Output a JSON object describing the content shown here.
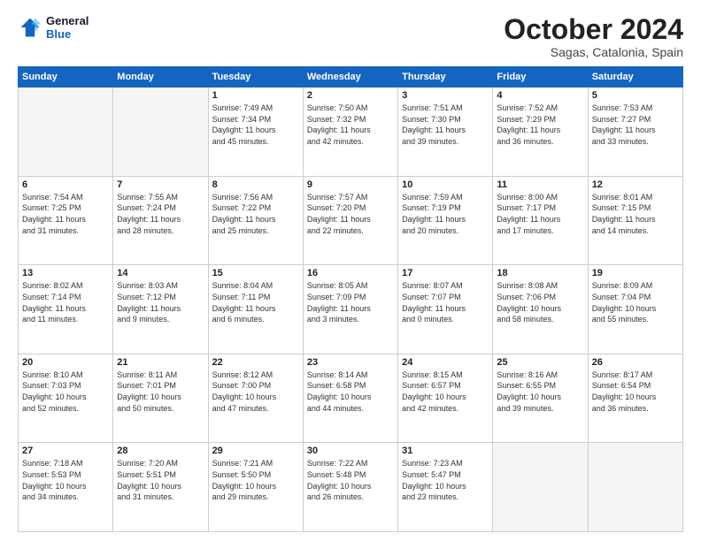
{
  "logo": {
    "line1": "General",
    "line2": "Blue"
  },
  "title": "October 2024",
  "location": "Sagas, Catalonia, Spain",
  "days_header": [
    "Sunday",
    "Monday",
    "Tuesday",
    "Wednesday",
    "Thursday",
    "Friday",
    "Saturday"
  ],
  "weeks": [
    [
      {
        "day": "",
        "info": ""
      },
      {
        "day": "",
        "info": ""
      },
      {
        "day": "1",
        "info": "Sunrise: 7:49 AM\nSunset: 7:34 PM\nDaylight: 11 hours\nand 45 minutes."
      },
      {
        "day": "2",
        "info": "Sunrise: 7:50 AM\nSunset: 7:32 PM\nDaylight: 11 hours\nand 42 minutes."
      },
      {
        "day": "3",
        "info": "Sunrise: 7:51 AM\nSunset: 7:30 PM\nDaylight: 11 hours\nand 39 minutes."
      },
      {
        "day": "4",
        "info": "Sunrise: 7:52 AM\nSunset: 7:29 PM\nDaylight: 11 hours\nand 36 minutes."
      },
      {
        "day": "5",
        "info": "Sunrise: 7:53 AM\nSunset: 7:27 PM\nDaylight: 11 hours\nand 33 minutes."
      }
    ],
    [
      {
        "day": "6",
        "info": "Sunrise: 7:54 AM\nSunset: 7:25 PM\nDaylight: 11 hours\nand 31 minutes."
      },
      {
        "day": "7",
        "info": "Sunrise: 7:55 AM\nSunset: 7:24 PM\nDaylight: 11 hours\nand 28 minutes."
      },
      {
        "day": "8",
        "info": "Sunrise: 7:56 AM\nSunset: 7:22 PM\nDaylight: 11 hours\nand 25 minutes."
      },
      {
        "day": "9",
        "info": "Sunrise: 7:57 AM\nSunset: 7:20 PM\nDaylight: 11 hours\nand 22 minutes."
      },
      {
        "day": "10",
        "info": "Sunrise: 7:59 AM\nSunset: 7:19 PM\nDaylight: 11 hours\nand 20 minutes."
      },
      {
        "day": "11",
        "info": "Sunrise: 8:00 AM\nSunset: 7:17 PM\nDaylight: 11 hours\nand 17 minutes."
      },
      {
        "day": "12",
        "info": "Sunrise: 8:01 AM\nSunset: 7:15 PM\nDaylight: 11 hours\nand 14 minutes."
      }
    ],
    [
      {
        "day": "13",
        "info": "Sunrise: 8:02 AM\nSunset: 7:14 PM\nDaylight: 11 hours\nand 11 minutes."
      },
      {
        "day": "14",
        "info": "Sunrise: 8:03 AM\nSunset: 7:12 PM\nDaylight: 11 hours\nand 9 minutes."
      },
      {
        "day": "15",
        "info": "Sunrise: 8:04 AM\nSunset: 7:11 PM\nDaylight: 11 hours\nand 6 minutes."
      },
      {
        "day": "16",
        "info": "Sunrise: 8:05 AM\nSunset: 7:09 PM\nDaylight: 11 hours\nand 3 minutes."
      },
      {
        "day": "17",
        "info": "Sunrise: 8:07 AM\nSunset: 7:07 PM\nDaylight: 11 hours\nand 0 minutes."
      },
      {
        "day": "18",
        "info": "Sunrise: 8:08 AM\nSunset: 7:06 PM\nDaylight: 10 hours\nand 58 minutes."
      },
      {
        "day": "19",
        "info": "Sunrise: 8:09 AM\nSunset: 7:04 PM\nDaylight: 10 hours\nand 55 minutes."
      }
    ],
    [
      {
        "day": "20",
        "info": "Sunrise: 8:10 AM\nSunset: 7:03 PM\nDaylight: 10 hours\nand 52 minutes."
      },
      {
        "day": "21",
        "info": "Sunrise: 8:11 AM\nSunset: 7:01 PM\nDaylight: 10 hours\nand 50 minutes."
      },
      {
        "day": "22",
        "info": "Sunrise: 8:12 AM\nSunset: 7:00 PM\nDaylight: 10 hours\nand 47 minutes."
      },
      {
        "day": "23",
        "info": "Sunrise: 8:14 AM\nSunset: 6:58 PM\nDaylight: 10 hours\nand 44 minutes."
      },
      {
        "day": "24",
        "info": "Sunrise: 8:15 AM\nSunset: 6:57 PM\nDaylight: 10 hours\nand 42 minutes."
      },
      {
        "day": "25",
        "info": "Sunrise: 8:16 AM\nSunset: 6:55 PM\nDaylight: 10 hours\nand 39 minutes."
      },
      {
        "day": "26",
        "info": "Sunrise: 8:17 AM\nSunset: 6:54 PM\nDaylight: 10 hours\nand 36 minutes."
      }
    ],
    [
      {
        "day": "27",
        "info": "Sunrise: 7:18 AM\nSunset: 5:53 PM\nDaylight: 10 hours\nand 34 minutes."
      },
      {
        "day": "28",
        "info": "Sunrise: 7:20 AM\nSunset: 5:51 PM\nDaylight: 10 hours\nand 31 minutes."
      },
      {
        "day": "29",
        "info": "Sunrise: 7:21 AM\nSunset: 5:50 PM\nDaylight: 10 hours\nand 29 minutes."
      },
      {
        "day": "30",
        "info": "Sunrise: 7:22 AM\nSunset: 5:48 PM\nDaylight: 10 hours\nand 26 minutes."
      },
      {
        "day": "31",
        "info": "Sunrise: 7:23 AM\nSunset: 5:47 PM\nDaylight: 10 hours\nand 23 minutes."
      },
      {
        "day": "",
        "info": ""
      },
      {
        "day": "",
        "info": ""
      }
    ]
  ]
}
